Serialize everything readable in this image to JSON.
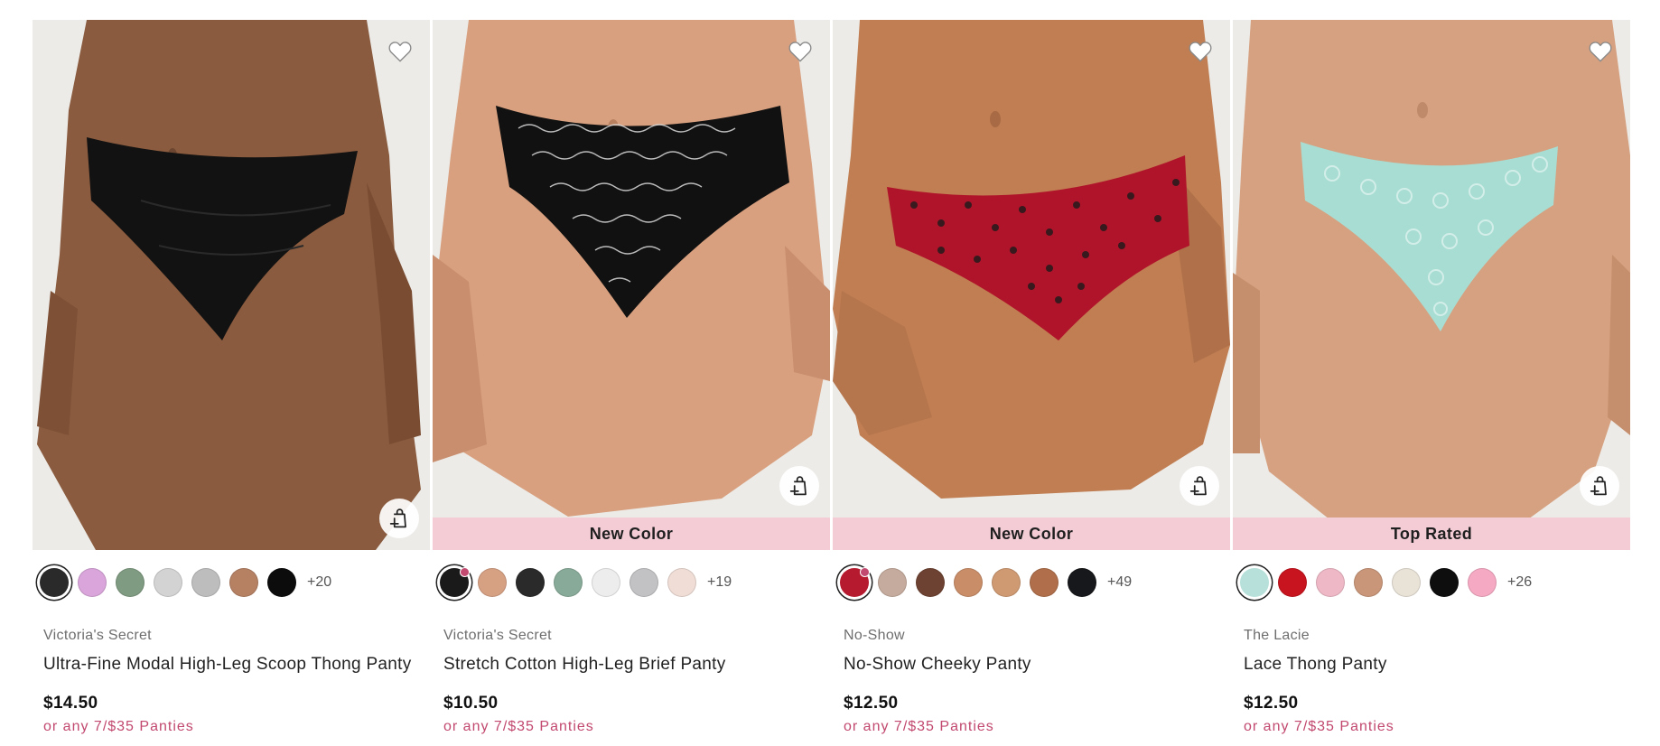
{
  "colors": {
    "promo": "#c2496f",
    "badge_bg": "#f3ccd6",
    "image_bg": "#ecebe8"
  },
  "products": [
    {
      "brand": "Victoria's Secret",
      "name": "Ultra-Fine Modal High-Leg Scoop Thong Panty",
      "price": "$14.50",
      "promo": "or any 7/$35 Panties",
      "badge": "",
      "more_colors": "+20",
      "swatch_colors": [
        "#2a2a2a",
        "#d9a5da",
        "#7f9b81",
        "#d3d3d3",
        "#bdbdbd",
        "#b68163",
        "#0c0c0c"
      ],
      "wishlist_icon": "heart-outline-icon",
      "bag_icon": "add-to-bag-icon"
    },
    {
      "brand": "Victoria's Secret",
      "name": "Stretch Cotton High-Leg Brief Panty",
      "price": "$10.50",
      "promo": "or any 7/$35 Panties",
      "badge": "New Color",
      "more_colors": "+19",
      "swatch_colors": [
        "#1a1a1a",
        "#d6a083",
        "#2a2a2a",
        "#88aa98",
        "#ededed",
        "#c2c2c4",
        "#f0ddd6"
      ],
      "wishlist_icon": "heart-outline-icon",
      "bag_icon": "add-to-bag-icon"
    },
    {
      "brand": "No-Show",
      "name": "No-Show Cheeky Panty",
      "price": "$12.50",
      "promo": "or any 7/$35 Panties",
      "badge": "New Color",
      "more_colors": "+49",
      "swatch_colors": [
        "#b51a2f",
        "#c5ab9d",
        "#6e4232",
        "#c98d68",
        "#cf9a72",
        "#b06f4a",
        "#17181b"
      ],
      "wishlist_icon": "heart-outline-icon",
      "bag_icon": "add-to-bag-icon"
    },
    {
      "brand": "The Lacie",
      "name": "Lace Thong Panty",
      "price": "$12.50",
      "promo": "or any 7/$35 Panties",
      "badge": "Top Rated",
      "more_colors": "+26",
      "swatch_colors": [
        "#b7e0da",
        "#c8141e",
        "#efb8c6",
        "#c99679",
        "#e9e2d7",
        "#0e0e0e",
        "#f5a9c2"
      ],
      "wishlist_icon": "heart-outline-icon",
      "bag_icon": "add-to-bag-icon"
    }
  ]
}
